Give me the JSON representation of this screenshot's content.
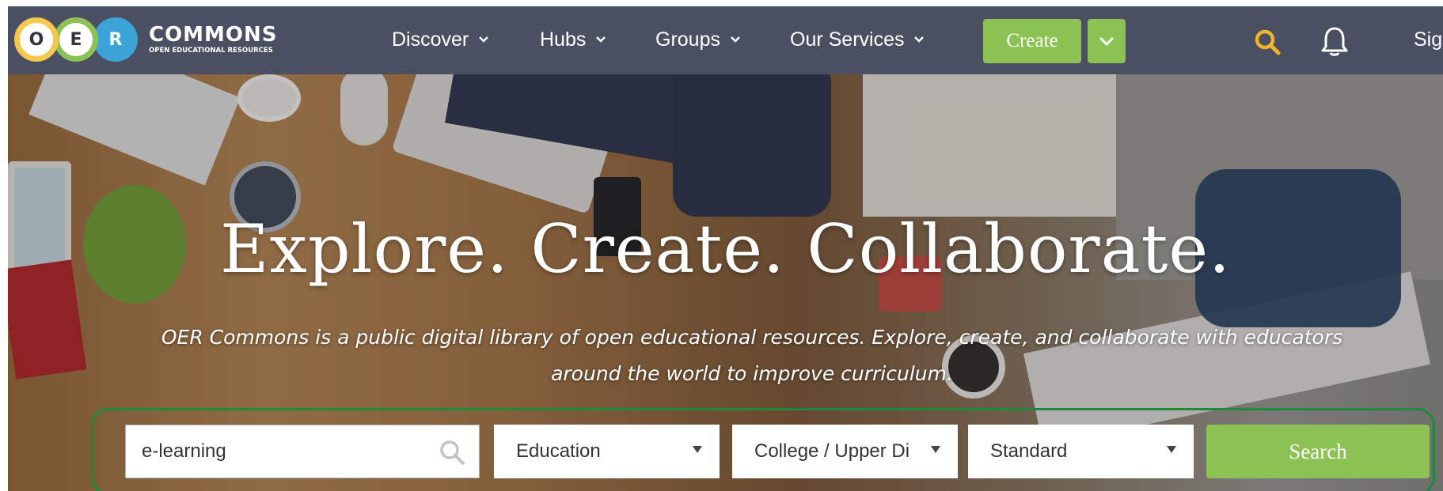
{
  "brand": {
    "letters": [
      "O",
      "E",
      "R"
    ],
    "name": "COMMONS",
    "tagline": "OPEN EDUCATIONAL RESOURCES"
  },
  "nav": {
    "items": [
      {
        "label": "Discover"
      },
      {
        "label": "Hubs"
      },
      {
        "label": "Groups"
      },
      {
        "label": "Our Services"
      }
    ],
    "create_label": "Create",
    "signin_label": "Sign"
  },
  "hero": {
    "title": "Explore. Create. Collaborate.",
    "description_line1": "OER Commons is a public digital library of open educational resources. Explore, create, and collaborate with educators",
    "description_line2": "around the world to improve curriculum."
  },
  "search": {
    "keyword_value": "e-learning",
    "subject_selected": "Education",
    "level_selected": "College / Upper Di",
    "standard_selected": "Standard",
    "button_label": "Search"
  },
  "colors": {
    "navbar": "#4a5062",
    "accent_green": "#8cc153",
    "logo_yellow": "#f3c84e",
    "logo_green": "#8cc153",
    "logo_blue": "#3ba3d8",
    "search_icon_gold": "#f0b429",
    "highlight_outline": "#1e8a3c"
  },
  "icons": {
    "nav_search": "search-icon",
    "notifications": "bell-icon",
    "create_dropdown": "chevron-down-icon",
    "keyword_search": "search-icon",
    "select_caret": "caret-down-icon"
  }
}
